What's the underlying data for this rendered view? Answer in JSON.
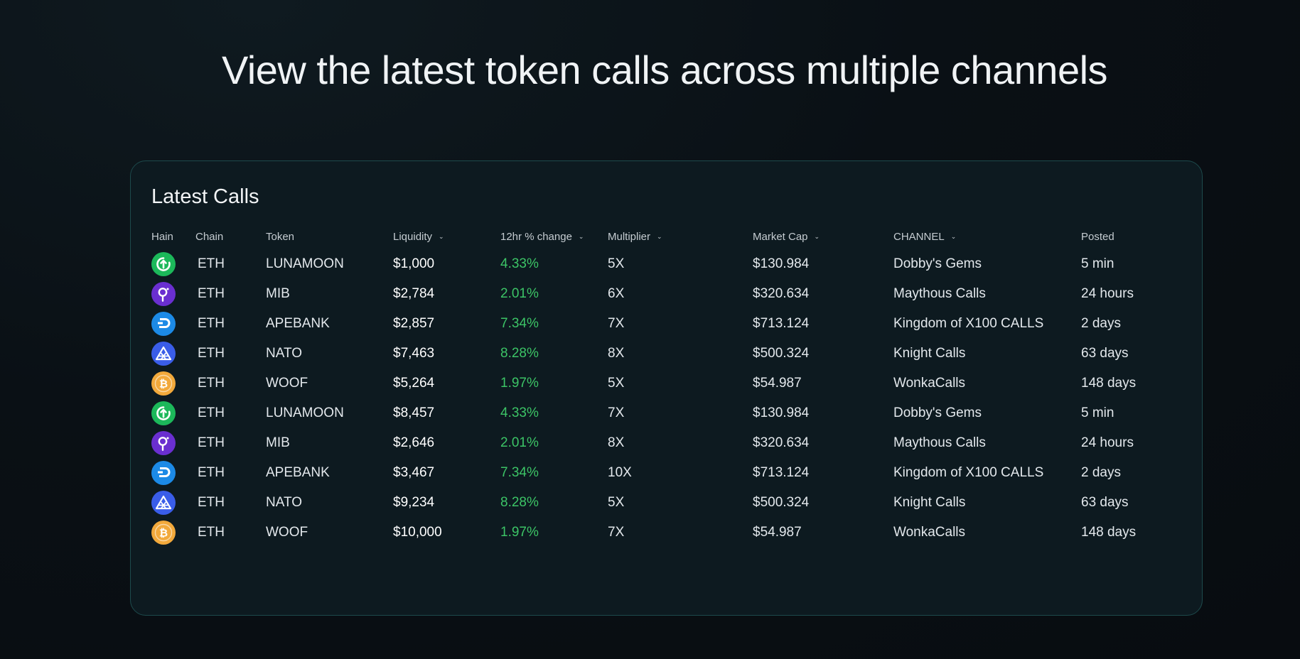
{
  "headline": "View the latest token calls across multiple channels",
  "table": {
    "title": "Latest Calls",
    "columns": {
      "hain": "Hain",
      "chain": "Chain",
      "token": "Token",
      "liquidity": "Liquidity",
      "change": "12hr % change",
      "multiplier": "Multiplier",
      "market_cap": "Market Cap",
      "channel": "CHANNEL",
      "posted": "Posted"
    },
    "rows": [
      {
        "icon": "green-circle-arrow-icon",
        "chain": "ETH",
        "token": "LUNAMOON",
        "liquidity": "$1,000",
        "change": "4.33%",
        "multiplier": "5X",
        "market_cap": "$130.984",
        "channel": "Dobby's Gems",
        "posted": "5 min"
      },
      {
        "icon": "purple-ring-icon",
        "chain": "ETH",
        "token": "MIB",
        "liquidity": "$2,784",
        "change": "2.01%",
        "multiplier": "6X",
        "market_cap": "$320.634",
        "channel": "Maythous Calls",
        "posted": "24 hours"
      },
      {
        "icon": "dash-coin-icon",
        "chain": "ETH",
        "token": "APEBANK",
        "liquidity": "$2,857",
        "change": "7.34%",
        "multiplier": "7X",
        "market_cap": "$713.124",
        "channel": "Kingdom of X100 CALLS",
        "posted": "2 days"
      },
      {
        "icon": "blue-triangle-icon",
        "chain": "ETH",
        "token": "NATO",
        "liquidity": "$7,463",
        "change": "8.28%",
        "multiplier": "8X",
        "market_cap": "$500.324",
        "channel": "Knight Calls",
        "posted": "63 days"
      },
      {
        "icon": "bitcoin-coin-icon",
        "chain": "ETH",
        "token": "WOOF",
        "liquidity": "$5,264",
        "change": "1.97%",
        "multiplier": "5X",
        "market_cap": "$54.987",
        "channel": "WonkaCalls",
        "posted": "148 days"
      },
      {
        "icon": "green-circle-arrow-icon",
        "chain": "ETH",
        "token": "LUNAMOON",
        "liquidity": "$8,457",
        "change": "4.33%",
        "multiplier": "7X",
        "market_cap": "$130.984",
        "channel": "Dobby's Gems",
        "posted": "5 min"
      },
      {
        "icon": "purple-ring-icon",
        "chain": "ETH",
        "token": "MIB",
        "liquidity": "$2,646",
        "change": "2.01%",
        "multiplier": "8X",
        "market_cap": "$320.634",
        "channel": "Maythous Calls",
        "posted": "24 hours"
      },
      {
        "icon": "dash-coin-icon",
        "chain": "ETH",
        "token": "APEBANK",
        "liquidity": "$3,467",
        "change": "7.34%",
        "multiplier": "10X",
        "market_cap": "$713.124",
        "channel": "Kingdom of X100 CALLS",
        "posted": "2 days"
      },
      {
        "icon": "blue-triangle-icon",
        "chain": "ETH",
        "token": "NATO",
        "liquidity": "$9,234",
        "change": "8.28%",
        "multiplier": "5X",
        "market_cap": "$500.324",
        "channel": "Knight Calls",
        "posted": "63 days"
      },
      {
        "icon": "bitcoin-coin-icon",
        "chain": "ETH",
        "token": "WOOF",
        "liquidity": "$10,000",
        "change": "1.97%",
        "multiplier": "7X",
        "market_cap": "$54.987",
        "channel": "WonkaCalls",
        "posted": "148 days"
      }
    ]
  },
  "colors": {
    "background": "#0a1015",
    "card_background": "#0d1a20",
    "card_border": "#1d4a4c",
    "positive_change": "#3cc466"
  }
}
